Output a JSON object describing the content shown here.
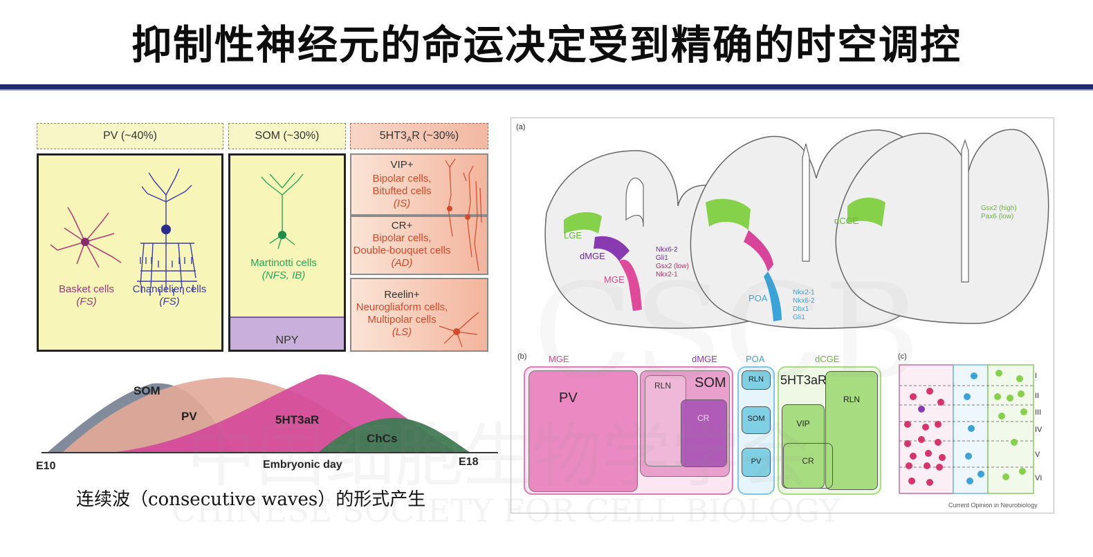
{
  "page": {
    "title": "抑制性神经元的命运决定受到精确的时空调控",
    "caption": "连续波（consecutive waves）的形式产生",
    "watermark_cn": "中国细胞生物学学会",
    "watermark_en": "CHINESE SOCIETY FOR CELL BIOLOGY",
    "watermark_logo": "CSCB"
  },
  "colors": {
    "title_rule": "#1f2b6b",
    "pv_fill": "#f7f6b8",
    "som_fill": "#f7f6b8",
    "htr_fill": "#f0a58c",
    "npy_fill": "#c9b0dc",
    "mge_pink": "#e04a9a",
    "lge_green": "#86d14a",
    "poa_blue": "#3aa3d8"
  },
  "left_panel": {
    "headers": {
      "pv": "PV (~40%)",
      "som": "SOM (~30%)",
      "htr_pre": "5HT3",
      "htr_sub": "A",
      "htr_post": "R (~30%)"
    },
    "pv_cells": [
      {
        "name": "Basket cells",
        "type": "(FS)"
      },
      {
        "name": "Chandelier cells",
        "type": "(FS)"
      }
    ],
    "som_cells": {
      "name": "Martinotti cells",
      "type": "(NFS, IB)"
    },
    "npy": "NPY",
    "htr_groups": [
      {
        "marker": "VIP+",
        "line1": "Bipolar cells,",
        "line2": "Bitufted cells",
        "type": "(IS)"
      },
      {
        "marker": "CR+",
        "line1": "Bipolar cells,",
        "line2": "Double-bouquet cells",
        "type": "(AD)"
      },
      {
        "marker": "Reelin+",
        "line1": "Neurogliaform cells,",
        "line2": "Multipolar cells",
        "type": "(LS)"
      }
    ]
  },
  "waves": {
    "labels": {
      "som": "SOM",
      "pv": "PV",
      "htr": "5HT3aR",
      "chcs": "ChCs"
    },
    "axis": {
      "start": "E10",
      "end": "E18",
      "label": "Embryonic day"
    }
  },
  "right_panel": {
    "a_label": "(a)",
    "b_label": "(b)",
    "c_label": "(c)",
    "section1": {
      "lge": "LGE",
      "dmge": "dMGE",
      "mge": "MGE",
      "genes": [
        "Nkx6-2",
        "Gli1",
        "Gsx2 (low)",
        "Nkx2-1"
      ]
    },
    "section2": {
      "poa": "POA",
      "genes": [
        "Nkx2-1",
        "Nkx6-2",
        "Dbx1",
        "Gli1"
      ]
    },
    "section3": {
      "dcge": "dCGE",
      "genes": [
        "Gsx2 (high)",
        "Pax6 (low)"
      ]
    },
    "b_headers": {
      "mge": "MGE",
      "dmge": "dMGE",
      "poa": "POA",
      "dcge": "dCGE"
    },
    "b_boxes": {
      "pv": "PV",
      "rln": "RLN",
      "som": "SOM",
      "cr": "CR",
      "poa_rln": "RLN",
      "poa_som": "SOM",
      "poa_pv": "PV",
      "htr": "5HT3aR",
      "vip": "VIP",
      "cr2": "CR",
      "rln2": "RLN"
    },
    "layers": [
      "I",
      "II",
      "III",
      "IV",
      "V",
      "VI"
    ],
    "credit": "Current Opinion in Neurobiology"
  }
}
